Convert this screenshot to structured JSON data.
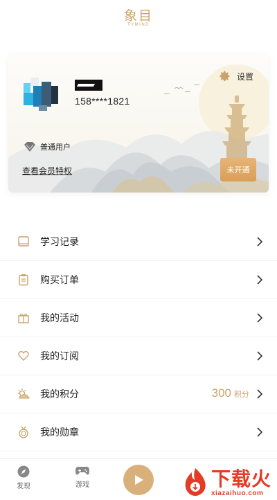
{
  "header": {
    "logo_cn": "象目",
    "logo_en": "TYMIND"
  },
  "profile": {
    "phone": "158****1821",
    "settings_label": "设置",
    "level_label": "普通用户",
    "member_link": "查看会员特权",
    "open_button": "未开通"
  },
  "menu": {
    "items": [
      {
        "label": "学习记录",
        "icon": "book-icon"
      },
      {
        "label": "购买订单",
        "icon": "clipboard-icon"
      },
      {
        "label": "我的活动",
        "icon": "gift-icon"
      },
      {
        "label": "我的订阅",
        "icon": "heart-icon"
      },
      {
        "label": "我的积分",
        "icon": "sun-cloud-icon",
        "points": "300",
        "points_unit": "积分"
      },
      {
        "label": "我的勋章",
        "icon": "medal-icon"
      }
    ]
  },
  "bottom_nav": {
    "discover": "发现",
    "games": "游戏"
  },
  "watermark": {
    "title": "下载火",
    "sub": "xiazaihuo.com"
  },
  "colors": {
    "gold": "#c9a36a",
    "button": "#d89e57",
    "watermark": "#e43b26"
  }
}
